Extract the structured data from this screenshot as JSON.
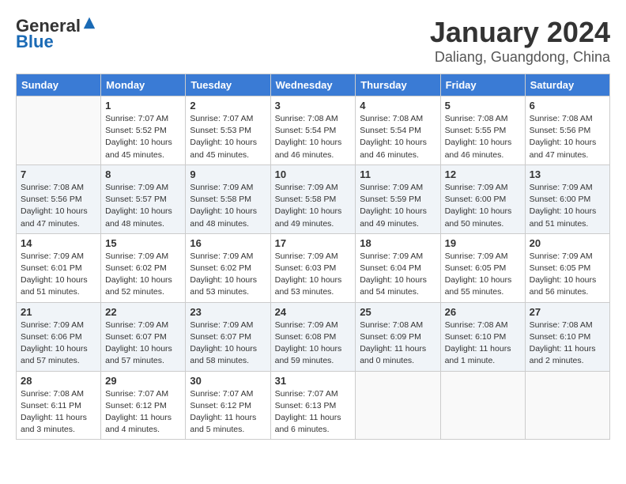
{
  "header": {
    "logo_general": "General",
    "logo_blue": "Blue",
    "month_title": "January 2024",
    "location": "Daliang, Guangdong, China"
  },
  "weekdays": [
    "Sunday",
    "Monday",
    "Tuesday",
    "Wednesday",
    "Thursday",
    "Friday",
    "Saturday"
  ],
  "weeks": [
    [
      {
        "num": "",
        "info": ""
      },
      {
        "num": "1",
        "info": "Sunrise: 7:07 AM\nSunset: 5:52 PM\nDaylight: 10 hours\nand 45 minutes."
      },
      {
        "num": "2",
        "info": "Sunrise: 7:07 AM\nSunset: 5:53 PM\nDaylight: 10 hours\nand 45 minutes."
      },
      {
        "num": "3",
        "info": "Sunrise: 7:08 AM\nSunset: 5:54 PM\nDaylight: 10 hours\nand 46 minutes."
      },
      {
        "num": "4",
        "info": "Sunrise: 7:08 AM\nSunset: 5:54 PM\nDaylight: 10 hours\nand 46 minutes."
      },
      {
        "num": "5",
        "info": "Sunrise: 7:08 AM\nSunset: 5:55 PM\nDaylight: 10 hours\nand 46 minutes."
      },
      {
        "num": "6",
        "info": "Sunrise: 7:08 AM\nSunset: 5:56 PM\nDaylight: 10 hours\nand 47 minutes."
      }
    ],
    [
      {
        "num": "7",
        "info": "Sunrise: 7:08 AM\nSunset: 5:56 PM\nDaylight: 10 hours\nand 47 minutes."
      },
      {
        "num": "8",
        "info": "Sunrise: 7:09 AM\nSunset: 5:57 PM\nDaylight: 10 hours\nand 48 minutes."
      },
      {
        "num": "9",
        "info": "Sunrise: 7:09 AM\nSunset: 5:58 PM\nDaylight: 10 hours\nand 48 minutes."
      },
      {
        "num": "10",
        "info": "Sunrise: 7:09 AM\nSunset: 5:58 PM\nDaylight: 10 hours\nand 49 minutes."
      },
      {
        "num": "11",
        "info": "Sunrise: 7:09 AM\nSunset: 5:59 PM\nDaylight: 10 hours\nand 49 minutes."
      },
      {
        "num": "12",
        "info": "Sunrise: 7:09 AM\nSunset: 6:00 PM\nDaylight: 10 hours\nand 50 minutes."
      },
      {
        "num": "13",
        "info": "Sunrise: 7:09 AM\nSunset: 6:00 PM\nDaylight: 10 hours\nand 51 minutes."
      }
    ],
    [
      {
        "num": "14",
        "info": "Sunrise: 7:09 AM\nSunset: 6:01 PM\nDaylight: 10 hours\nand 51 minutes."
      },
      {
        "num": "15",
        "info": "Sunrise: 7:09 AM\nSunset: 6:02 PM\nDaylight: 10 hours\nand 52 minutes."
      },
      {
        "num": "16",
        "info": "Sunrise: 7:09 AM\nSunset: 6:02 PM\nDaylight: 10 hours\nand 53 minutes."
      },
      {
        "num": "17",
        "info": "Sunrise: 7:09 AM\nSunset: 6:03 PM\nDaylight: 10 hours\nand 53 minutes."
      },
      {
        "num": "18",
        "info": "Sunrise: 7:09 AM\nSunset: 6:04 PM\nDaylight: 10 hours\nand 54 minutes."
      },
      {
        "num": "19",
        "info": "Sunrise: 7:09 AM\nSunset: 6:05 PM\nDaylight: 10 hours\nand 55 minutes."
      },
      {
        "num": "20",
        "info": "Sunrise: 7:09 AM\nSunset: 6:05 PM\nDaylight: 10 hours\nand 56 minutes."
      }
    ],
    [
      {
        "num": "21",
        "info": "Sunrise: 7:09 AM\nSunset: 6:06 PM\nDaylight: 10 hours\nand 57 minutes."
      },
      {
        "num": "22",
        "info": "Sunrise: 7:09 AM\nSunset: 6:07 PM\nDaylight: 10 hours\nand 57 minutes."
      },
      {
        "num": "23",
        "info": "Sunrise: 7:09 AM\nSunset: 6:07 PM\nDaylight: 10 hours\nand 58 minutes."
      },
      {
        "num": "24",
        "info": "Sunrise: 7:09 AM\nSunset: 6:08 PM\nDaylight: 10 hours\nand 59 minutes."
      },
      {
        "num": "25",
        "info": "Sunrise: 7:08 AM\nSunset: 6:09 PM\nDaylight: 11 hours\nand 0 minutes."
      },
      {
        "num": "26",
        "info": "Sunrise: 7:08 AM\nSunset: 6:10 PM\nDaylight: 11 hours\nand 1 minute."
      },
      {
        "num": "27",
        "info": "Sunrise: 7:08 AM\nSunset: 6:10 PM\nDaylight: 11 hours\nand 2 minutes."
      }
    ],
    [
      {
        "num": "28",
        "info": "Sunrise: 7:08 AM\nSunset: 6:11 PM\nDaylight: 11 hours\nand 3 minutes."
      },
      {
        "num": "29",
        "info": "Sunrise: 7:07 AM\nSunset: 6:12 PM\nDaylight: 11 hours\nand 4 minutes."
      },
      {
        "num": "30",
        "info": "Sunrise: 7:07 AM\nSunset: 6:12 PM\nDaylight: 11 hours\nand 5 minutes."
      },
      {
        "num": "31",
        "info": "Sunrise: 7:07 AM\nSunset: 6:13 PM\nDaylight: 11 hours\nand 6 minutes."
      },
      {
        "num": "",
        "info": ""
      },
      {
        "num": "",
        "info": ""
      },
      {
        "num": "",
        "info": ""
      }
    ]
  ]
}
